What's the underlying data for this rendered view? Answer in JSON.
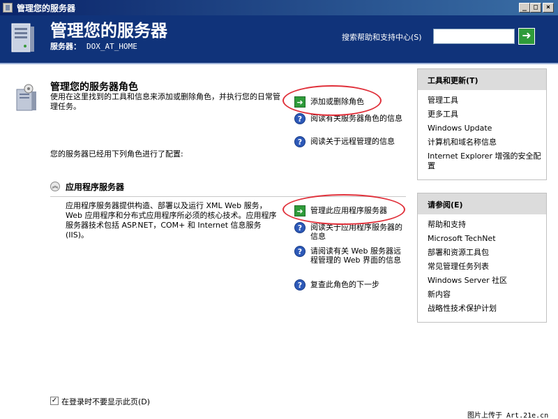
{
  "window": {
    "title": "管理您的服务器",
    "buttons": {
      "minimize": "_",
      "maximize": "□",
      "close": "×"
    }
  },
  "header": {
    "title": "管理您的服务器",
    "server_label": "服务器：",
    "server_name": "DOX_AT_HOME",
    "search_label": "搜索帮助和支持中心(S)",
    "search_value": "",
    "search_go": "➜",
    "accent": "#10337a"
  },
  "main": {
    "title": "管理您的服务器角色",
    "description": "使用在这里找到的工具和信息来添加或删除角色，并执行您的日常管理任务。",
    "actions": [
      {
        "label": "添加或删除角色",
        "icon": "arrow-icon"
      },
      {
        "label": "阅读有关服务器角色的信息",
        "icon": "help-icon"
      },
      {
        "label": "阅读关于远程管理的信息",
        "icon": "help-icon"
      }
    ],
    "configured_text": "您的服务器已经用下列角色进行了配置:",
    "role": {
      "title": "应用程序服务器",
      "collapse_icon": "︽",
      "description": "应用程序服务器提供构造、部署以及运行 XML Web 服务，Web 应用程序和分布式应用程序所必须的核心技术。应用程序服务器技术包括 ASP.NET，COM+ 和 Internet 信息服务(IIS)。",
      "actions": [
        {
          "label": "管理此应用程序服务器",
          "icon": "arrow-icon"
        },
        {
          "label": "阅读关于应用程序服务器的信息",
          "icon": "help-icon"
        },
        {
          "label": "请阅读有关 Web 服务器远程管理的 Web 界面的信息",
          "icon": "help-icon"
        },
        {
          "label": "复查此角色的下一步",
          "icon": "help-icon"
        }
      ]
    }
  },
  "tools_panel": {
    "title": "工具和更新(T)",
    "items": [
      "管理工具",
      "更多工具",
      "Windows Update",
      "计算机和域名称信息",
      "Internet Explorer 增强的安全配置"
    ]
  },
  "see_also_panel": {
    "title": "请参阅(E)",
    "items": [
      "帮助和支持",
      "Microsoft TechNet",
      "部署和资源工具包",
      "常见管理任务列表",
      "Windows Server 社区",
      "新内容",
      "战略性技术保护计划"
    ]
  },
  "footer": {
    "checkbox_label": "在登录时不要显示此页(D)",
    "checked": true,
    "checkmark": "✓",
    "watermark": "图片上传于 Art.21e.cn"
  },
  "colors": {
    "callout": "#e0303a",
    "action_green": "#2f9b3a",
    "help_blue": "#2d59b8"
  }
}
